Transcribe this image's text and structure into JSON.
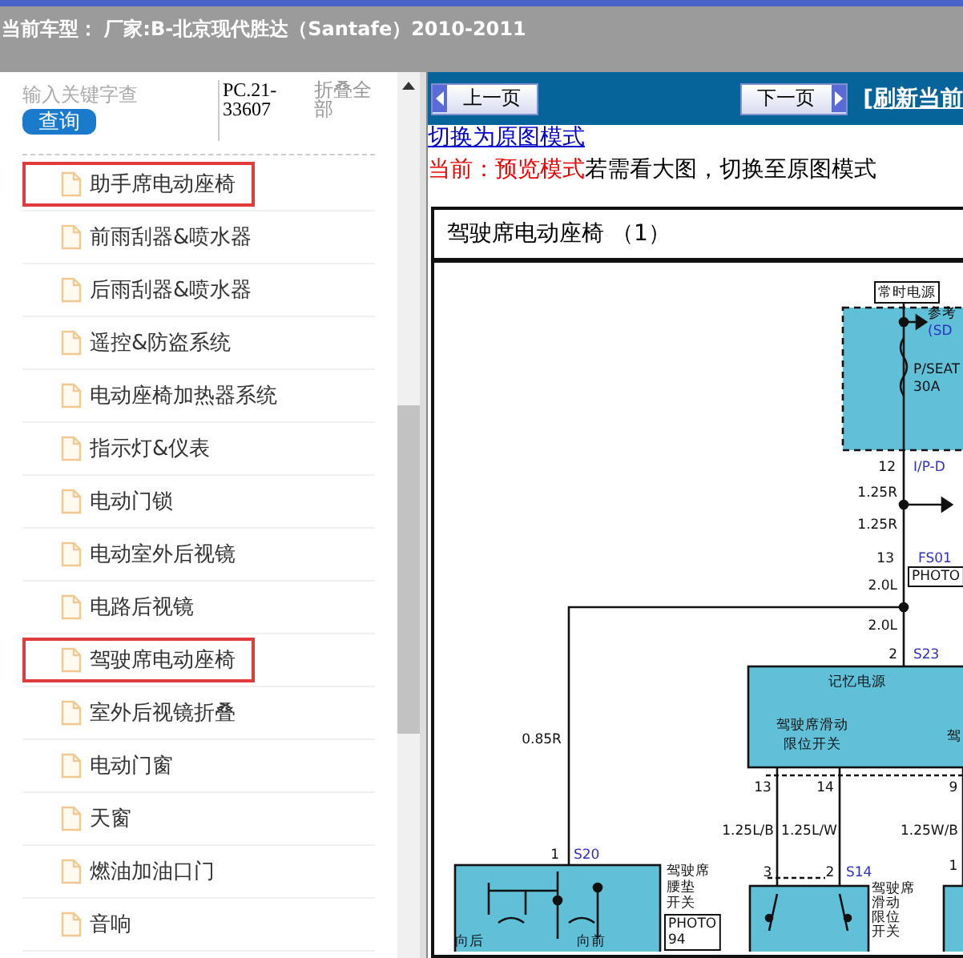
{
  "top_bar": {
    "title": "当前车型： 厂家:B-北京现代胜达（Santafe）2010-2011"
  },
  "sidebar": {
    "search": {
      "placeholder": "输入关键字查"
    },
    "search_button": "查询",
    "code": "PC.21-33607",
    "collapse_all": "折叠全部",
    "items": [
      {
        "label": "助手席电动座椅",
        "highlighted": true
      },
      {
        "label": "前雨刮器&喷水器",
        "highlighted": false
      },
      {
        "label": "后雨刮器&喷水器",
        "highlighted": false
      },
      {
        "label": "遥控&防盗系统",
        "highlighted": false
      },
      {
        "label": "电动座椅加热器系统",
        "highlighted": false
      },
      {
        "label": "指示灯&仪表",
        "highlighted": false
      },
      {
        "label": "电动门锁",
        "highlighted": false
      },
      {
        "label": "电动室外后视镜",
        "highlighted": false
      },
      {
        "label": "电路后视镜",
        "highlighted": false
      },
      {
        "label": "驾驶席电动座椅",
        "highlighted": true
      },
      {
        "label": "室外后视镜折叠",
        "highlighted": false
      },
      {
        "label": "电动门窗",
        "highlighted": false
      },
      {
        "label": "天窗",
        "highlighted": false
      },
      {
        "label": "燃油加油口门",
        "highlighted": false
      },
      {
        "label": "音响",
        "highlighted": false
      }
    ]
  },
  "viewer": {
    "prev_button": "上一页",
    "next_button": "下一页",
    "refresh_link": "[刷新当前",
    "original_mode_link": "切换为原图模式",
    "current_mode": "当前：预览模式",
    "mode_hint": "若需看大图，切换至原图模式",
    "diagram": {
      "title": "驾驶席电动座椅 （1）",
      "labels": [
        {
          "kind": "tag",
          "lines": [
            "常时电源"
          ]
        },
        {
          "kind": "text",
          "lines": [
            "参考"
          ]
        },
        {
          "kind": "connector",
          "lines": [
            "(SD"
          ]
        },
        {
          "kind": "text",
          "lines": [
            "P/SEAT",
            "30A"
          ]
        },
        {
          "kind": "text",
          "lines": [
            "12"
          ]
        },
        {
          "kind": "connector",
          "lines": [
            "I/P-D"
          ]
        },
        {
          "kind": "text",
          "lines": [
            "1.25R"
          ]
        },
        {
          "kind": "text",
          "lines": [
            "1.25R"
          ]
        },
        {
          "kind": "text",
          "lines": [
            "13"
          ]
        },
        {
          "kind": "connector",
          "lines": [
            "FS01"
          ]
        },
        {
          "kind": "tag",
          "lines": [
            "PHOTO"
          ]
        },
        {
          "kind": "text",
          "lines": [
            "2.0L"
          ]
        },
        {
          "kind": "text",
          "lines": [
            "2.0L"
          ]
        },
        {
          "kind": "text",
          "lines": [
            "2"
          ]
        },
        {
          "kind": "connector",
          "lines": [
            "S23"
          ]
        },
        {
          "kind": "text",
          "lines": [
            "记忆电源"
          ]
        },
        {
          "kind": "text",
          "lines": [
            "0.85R"
          ]
        },
        {
          "kind": "text",
          "lines": [
            "驾驶席滑动",
            "限位开关"
          ]
        },
        {
          "kind": "text",
          "lines": [
            "驾"
          ]
        },
        {
          "kind": "text",
          "lines": [
            "13"
          ]
        },
        {
          "kind": "text",
          "lines": [
            "14"
          ]
        },
        {
          "kind": "text",
          "lines": [
            "9"
          ]
        },
        {
          "kind": "text",
          "lines": [
            "1.25L/B"
          ]
        },
        {
          "kind": "text",
          "lines": [
            "1.25L/W"
          ]
        },
        {
          "kind": "text",
          "lines": [
            "1.25W/B"
          ]
        },
        {
          "kind": "text",
          "lines": [
            "1"
          ]
        },
        {
          "kind": "connector",
          "lines": [
            "S20"
          ]
        },
        {
          "kind": "text",
          "lines": [
            "驾驶席",
            "腰垫",
            "开关"
          ]
        },
        {
          "kind": "tag",
          "lines": [
            "PHOTO",
            "94"
          ]
        },
        {
          "kind": "text",
          "lines": [
            "3"
          ]
        },
        {
          "kind": "text",
          "lines": [
            "2"
          ]
        },
        {
          "kind": "connector",
          "lines": [
            "S14"
          ]
        },
        {
          "kind": "text",
          "lines": [
            "驾驶席",
            "滑动",
            "限位",
            "开关"
          ]
        },
        {
          "kind": "text",
          "lines": [
            "1"
          ]
        },
        {
          "kind": "text",
          "lines": [
            "向后"
          ]
        },
        {
          "kind": "text",
          "lines": [
            "向前"
          ]
        }
      ]
    }
  }
}
